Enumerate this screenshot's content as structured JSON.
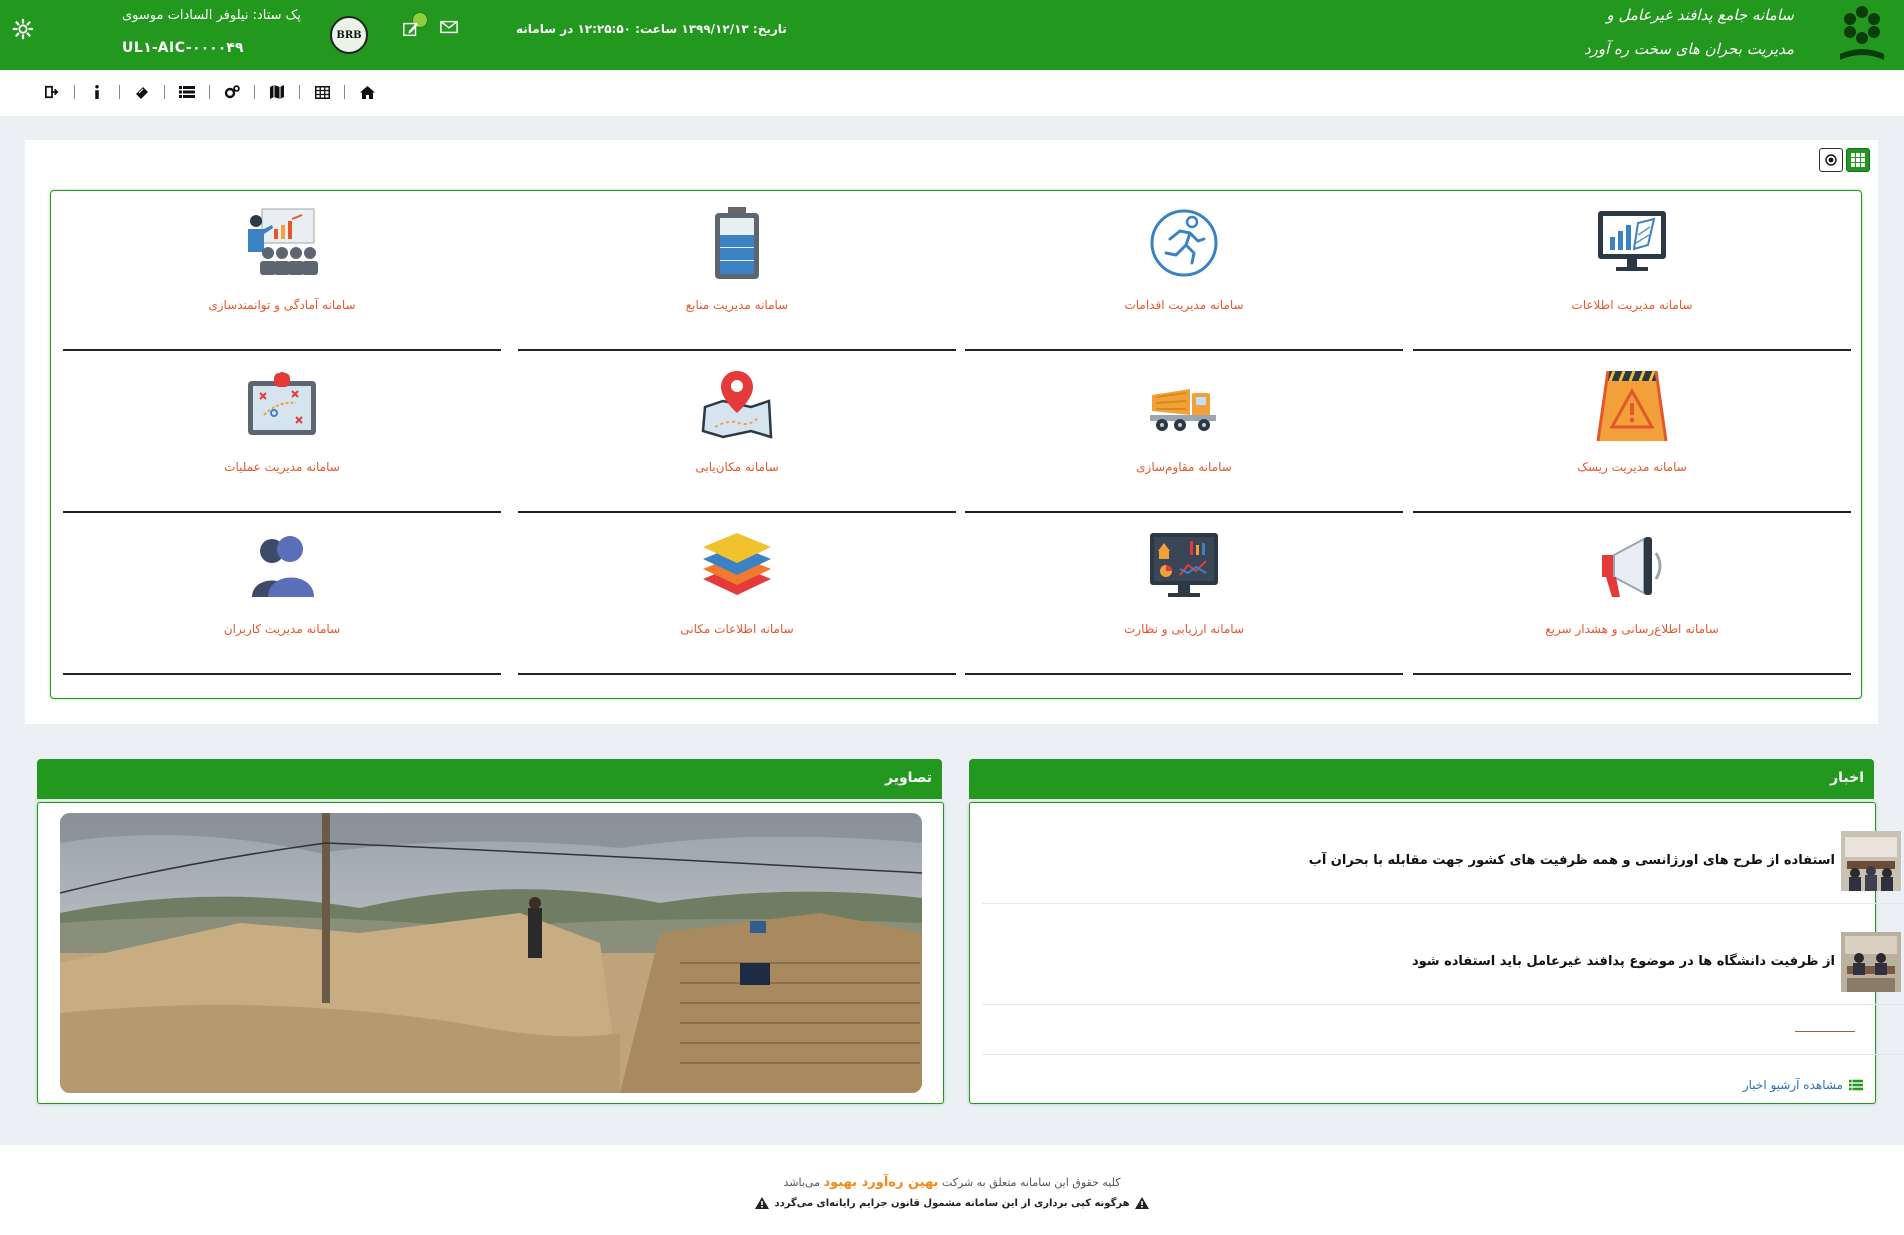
{
  "header": {
    "user_line": "پک ستاد: نیلوفر السادات موسوی",
    "user_code": "UL۱-AIC-۰۰۰۰۴۹",
    "logo_badge": "BRB",
    "datetime": "تاریخ: ۱۳۹۹/۱۲/۱۳ ساعت: ۱۲:۲۵:۵۰ در سامانه",
    "brand_line1": "سامانه جامع پدافند غیرعامل و",
    "brand_line2": "مدیریت بحران های سخت ره آورد",
    "colors": {
      "primary": "#23981e",
      "accent": "#e4572e"
    }
  },
  "toolbar": {
    "icons": [
      "sign-out-icon",
      "info-icon",
      "ticket-icon",
      "list-icon",
      "cogs-icon",
      "map-icon",
      "table-icon",
      "home-icon"
    ]
  },
  "systems": [
    {
      "label": "سامانه مدیریت اطلاعات",
      "icon": "info-monitor-icon"
    },
    {
      "label": "سامانه مدیریت اقدامات",
      "icon": "runner-icon"
    },
    {
      "label": "سامانه مدیریت منابع",
      "icon": "battery-icon"
    },
    {
      "label": "سامانه آمادگی و توانمندسازی",
      "icon": "presentation-icon"
    },
    {
      "label": "سامانه مدیریت ریسک",
      "icon": "warning-sign-icon"
    },
    {
      "label": "سامانه مقاوم‌سازی",
      "icon": "mixer-truck-icon"
    },
    {
      "label": "سامانه مکان‌یابی",
      "icon": "map-pin-icon"
    },
    {
      "label": "سامانه مدیریت عملیات",
      "icon": "tactics-board-icon"
    },
    {
      "label": "سامانه اطلاع‌رسانی و هشدار سریع",
      "icon": "megaphone-icon"
    },
    {
      "label": "سامانه ارزیابی و نظارت",
      "icon": "dashboard-monitor-icon"
    },
    {
      "label": "سامانه اطلاعات مکانی",
      "icon": "layers-icon"
    },
    {
      "label": "سامانه مدیریت کاربران",
      "icon": "users-icon"
    }
  ],
  "gallery": {
    "title": "تصاویر"
  },
  "news": {
    "title": "اخبار",
    "items": [
      {
        "title": "استفاده از طرح های اورژانسی و همه ظرفیت های کشور جهت مقابله با بحران آب"
      },
      {
        "title": "از ظرفیت دانشگاه ها در موضوع پدافند غیرعامل باید استفاده شود"
      }
    ],
    "archive_label": "مشاهده آرشیو اخبار"
  },
  "footer": {
    "rights_prefix": "کلیه حقوق این سامانه متعلق به شرکت",
    "company": "بهین ره‌آورد بهبود",
    "rights_suffix": "می‌باشد",
    "warning": "هرگونه کپی برداری از این سامانه مشمول قانون جرایم رایانه‌ای می‌گردد"
  }
}
